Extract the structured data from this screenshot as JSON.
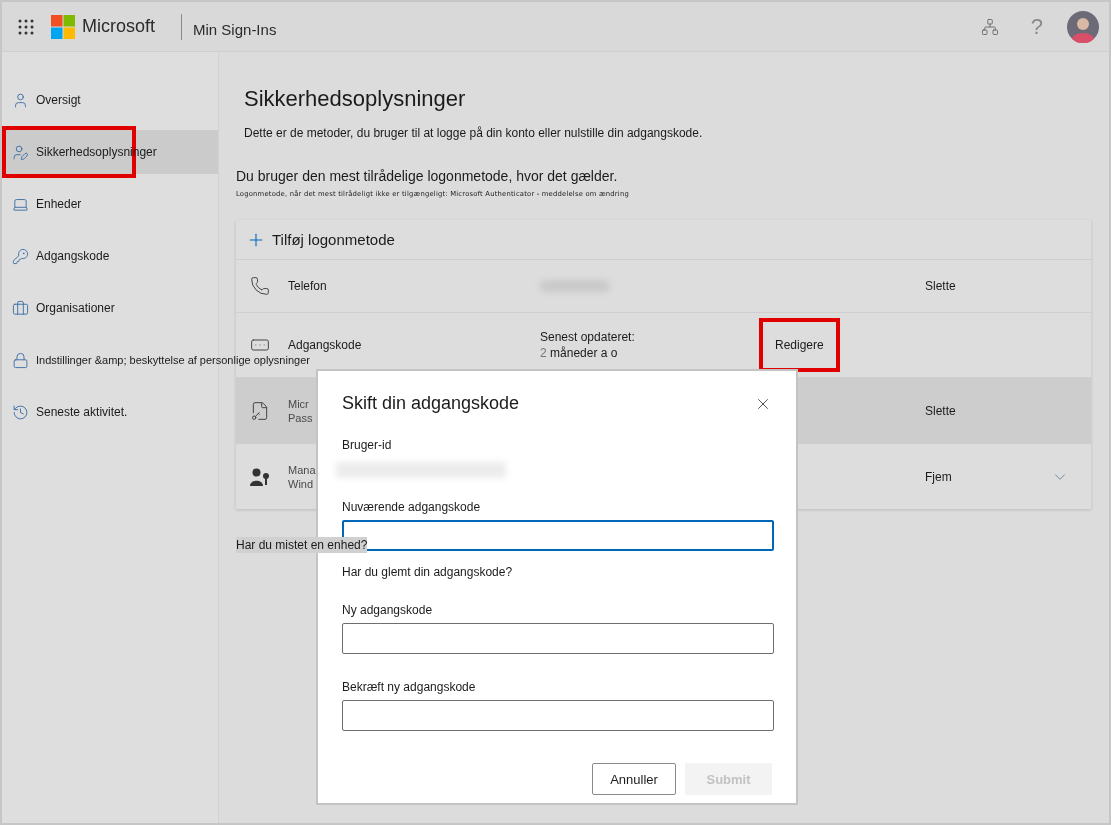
{
  "header": {
    "brand": "Microsoft",
    "app_title": "Min Sign-Ins",
    "help": "?"
  },
  "sidebar": {
    "items": [
      {
        "kind": "user",
        "label": "Oversigt",
        "selected": false,
        "highlighted": false
      },
      {
        "kind": "user-edit",
        "label": "Sikkerhedsoplysninger",
        "selected": true,
        "highlighted": true
      },
      {
        "kind": "laptop",
        "label": "Enheder",
        "selected": false,
        "highlighted": false
      },
      {
        "kind": "key",
        "label": "Adgangskode",
        "selected": false,
        "highlighted": false
      },
      {
        "kind": "briefcase",
        "label": "Organisationer",
        "selected": false,
        "highlighted": false
      },
      {
        "kind": "lock",
        "label": "Indstillinger &amp; beskyttelse af personlige oplysninger",
        "selected": false,
        "highlighted": false
      },
      {
        "kind": "history",
        "label": "Seneste aktivitet.",
        "selected": false,
        "highlighted": false
      }
    ]
  },
  "main": {
    "title": "Sikkerhedsoplysninger",
    "description": "Dette er de metoder, du bruger til at logge på din konto eller nulstille din adgangskode.",
    "default_note": "Du bruger den mest tilrådelige logonmetode, hvor det gælder.",
    "fallback_note": "Logonmetode, når det mest tilrådeligt ikke er tilgængeligt: Microsoft Authenticator - meddelelse om ændring",
    "add_method": "Tilføj logonmetode",
    "methods": [
      {
        "kind": "phone",
        "name": [
          "Telefon"
        ],
        "redacted": true,
        "action": "Slette",
        "action_highlighted": false,
        "shaded": false,
        "expandable": false
      },
      {
        "kind": "password",
        "name": [
          "Adgangskode"
        ],
        "detail_label": "Senest opdateret:",
        "detail_count": "2",
        "detail_value": "måneder a o",
        "action": "Redigere",
        "action_highlighted": true,
        "shaded": false,
        "expandable": false
      },
      {
        "kind": "passwordless",
        "name": [
          "Micr",
          "Pass"
        ],
        "action": "Slette",
        "action_highlighted": false,
        "shaded": true,
        "expandable": false
      },
      {
        "kind": "hello",
        "name": [
          "Mana",
          "Wind"
        ],
        "action": "Fjem",
        "action_highlighted": false,
        "shaded": false,
        "expandable": true
      }
    ],
    "lost_device": "Har du mistet en enhed?"
  },
  "dialog": {
    "title": "Skift din adgangskode",
    "user_id_label": "Bruger-id",
    "user_id_redacted": true,
    "fields": [
      {
        "label": "Nuværende adgangskode",
        "focused": true
      },
      {
        "label": "Ny adgangskode",
        "focused": false
      },
      {
        "label": "Bekræft ny adgangskode",
        "focused": false
      }
    ],
    "forgot_link": "Har du glemt din adgangskode?",
    "buttons": [
      {
        "kind": "secondary",
        "label": "Annuller",
        "disabled": false
      },
      {
        "kind": "primary",
        "label": "Submit",
        "disabled": true
      }
    ]
  }
}
